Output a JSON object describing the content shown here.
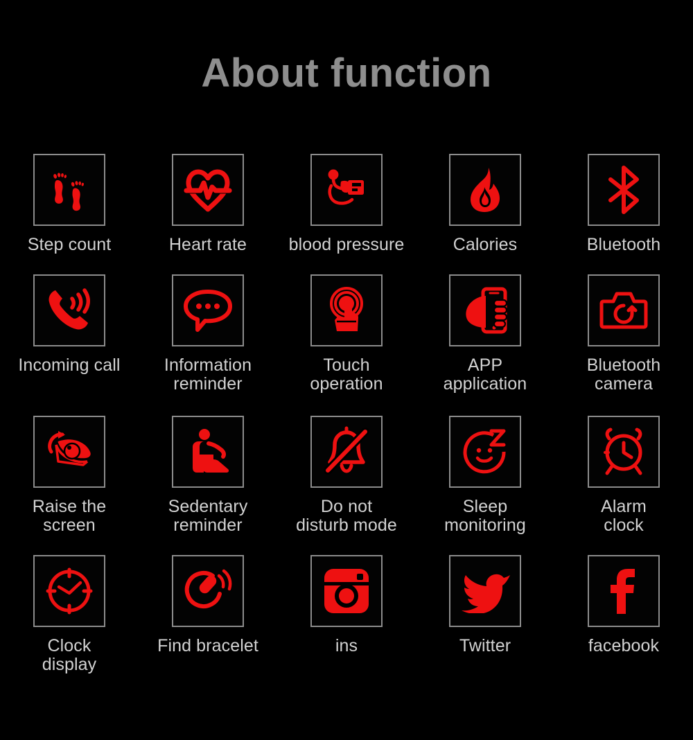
{
  "page": {
    "title": "About function",
    "background_color": "#000000",
    "accent_color": "#ee1111",
    "border_color": "#8c8c8c",
    "label_color": "#d2d2d2",
    "title_color": "#8e8e8e"
  },
  "grid": {
    "columns": 5,
    "rows": 4,
    "items": [
      {
        "icon": "footprints-icon",
        "label": "Step count"
      },
      {
        "icon": "heart-rate-icon",
        "label": "Heart rate"
      },
      {
        "icon": "blood-pressure-icon",
        "label": "blood pressure"
      },
      {
        "icon": "flame-icon",
        "label": "Calories"
      },
      {
        "icon": "bluetooth-icon",
        "label": "Bluetooth"
      },
      {
        "icon": "incoming-call-icon",
        "label": "Incoming call"
      },
      {
        "icon": "speech-bubble-icon",
        "label": "Information\nreminder"
      },
      {
        "icon": "touch-operation-icon",
        "label": "Touch\noperation"
      },
      {
        "icon": "hand-phone-icon",
        "label": "APP\napplication"
      },
      {
        "icon": "camera-icon",
        "label": "Bluetooth\ncamera"
      },
      {
        "icon": "raise-screen-eye-icon",
        "label": "Raise the\nscreen"
      },
      {
        "icon": "sitting-person-icon",
        "label": "Sedentary\nreminder"
      },
      {
        "icon": "bell-muted-icon",
        "label": "Do not\ndisturb mode"
      },
      {
        "icon": "sleep-face-icon",
        "label": "Sleep\nmonitoring"
      },
      {
        "icon": "alarm-clock-icon",
        "label": "Alarm\nclock"
      },
      {
        "icon": "clock-face-icon",
        "label": "Clock\ndisplay"
      },
      {
        "icon": "find-bracelet-icon",
        "label": "Find bracelet"
      },
      {
        "icon": "instagram-icon",
        "label": "ins"
      },
      {
        "icon": "twitter-bird-icon",
        "label": "Twitter"
      },
      {
        "icon": "facebook-icon",
        "label": "facebook"
      }
    ]
  }
}
